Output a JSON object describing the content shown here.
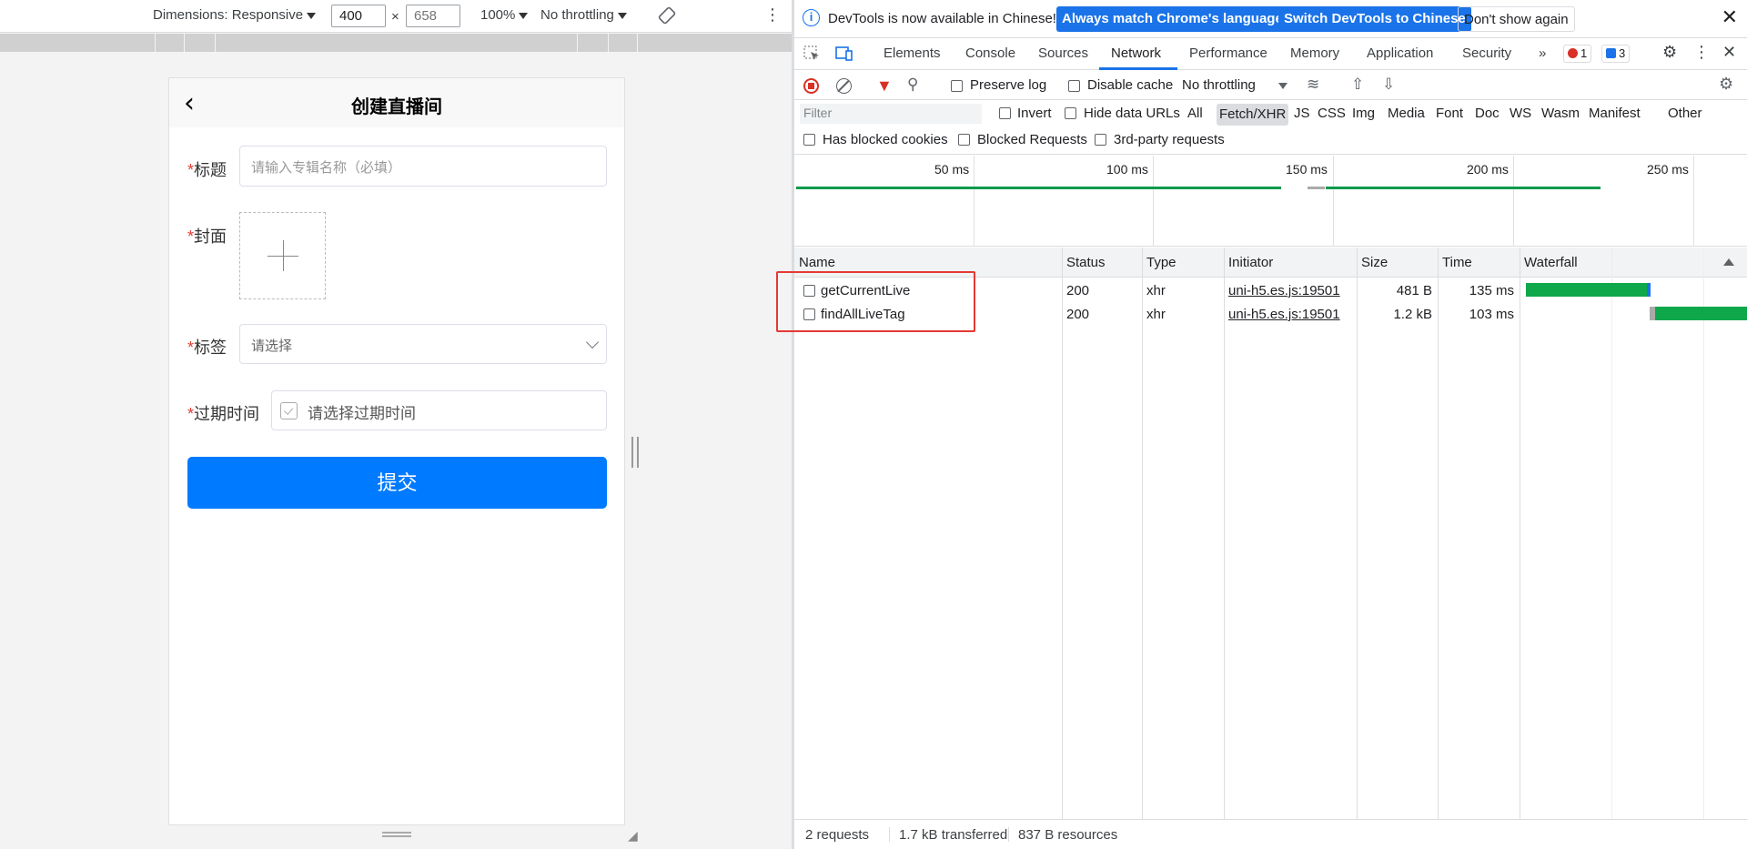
{
  "device_toolbar": {
    "dimensions_label": "Dimensions: Responsive",
    "width_value": "400",
    "height_placeholder": "658",
    "times": "×",
    "zoom": "100%",
    "throttling": "No throttling"
  },
  "app": {
    "title": "创建直播间",
    "fields": {
      "title_label": "标题",
      "title_placeholder": "请输入专辑名称（必填）",
      "cover_label": "封面",
      "tag_label": "标签",
      "tag_placeholder": "请选择",
      "expire_label": "过期时间",
      "expire_placeholder": "请选择过期时间",
      "required_mark": "*"
    },
    "submit_label": "提交"
  },
  "devtools": {
    "infobar": {
      "message": "DevTools is now available in Chinese!",
      "match_button": "Always match Chrome's language",
      "switch_button": "Switch DevTools to Chinese",
      "dismiss_button": "Don't show again"
    },
    "tabs": [
      "Elements",
      "Console",
      "Sources",
      "Network",
      "Performance",
      "Memory",
      "Application",
      "Security"
    ],
    "active_tab": "Network",
    "errors_count": "1",
    "messages_count": "3",
    "network_toolbar": {
      "preserve_log": "Preserve log",
      "disable_cache": "Disable cache",
      "throttling": "No throttling"
    },
    "filter": {
      "placeholder": "Filter",
      "invert": "Invert",
      "hide_data_urls": "Hide data URLs",
      "types": [
        "All",
        "Fetch/XHR",
        "JS",
        "CSS",
        "Img",
        "Media",
        "Font",
        "Doc",
        "WS",
        "Wasm",
        "Manifest",
        "Other"
      ],
      "selected_type": "Fetch/XHR",
      "has_blocked_cookies": "Has blocked cookies",
      "blocked_requests": "Blocked Requests",
      "third_party": "3rd-party requests"
    },
    "overview_ticks": [
      "50 ms",
      "100 ms",
      "150 ms",
      "200 ms",
      "250 ms"
    ],
    "table": {
      "columns": [
        "Name",
        "Status",
        "Type",
        "Initiator",
        "Size",
        "Time",
        "Waterfall"
      ],
      "rows": [
        {
          "name": "getCurrentLive",
          "status": "200",
          "type": "xhr",
          "initiator": "uni-h5.es.js:19501",
          "size": "481 B",
          "time": "135 ms"
        },
        {
          "name": "findAllLiveTag",
          "status": "200",
          "type": "xhr",
          "initiator": "uni-h5.es.js:19501",
          "size": "1.2 kB",
          "time": "103 ms"
        }
      ]
    },
    "status": {
      "requests": "2 requests",
      "transferred": "1.7 kB transferred",
      "resources": "837 B resources"
    }
  },
  "colors": {
    "primary": "#007aff",
    "devtools_blue": "#1a73e8",
    "required": "#e43d33",
    "waterfall_green": "#0ea84a",
    "highlight_red": "#e53935"
  }
}
